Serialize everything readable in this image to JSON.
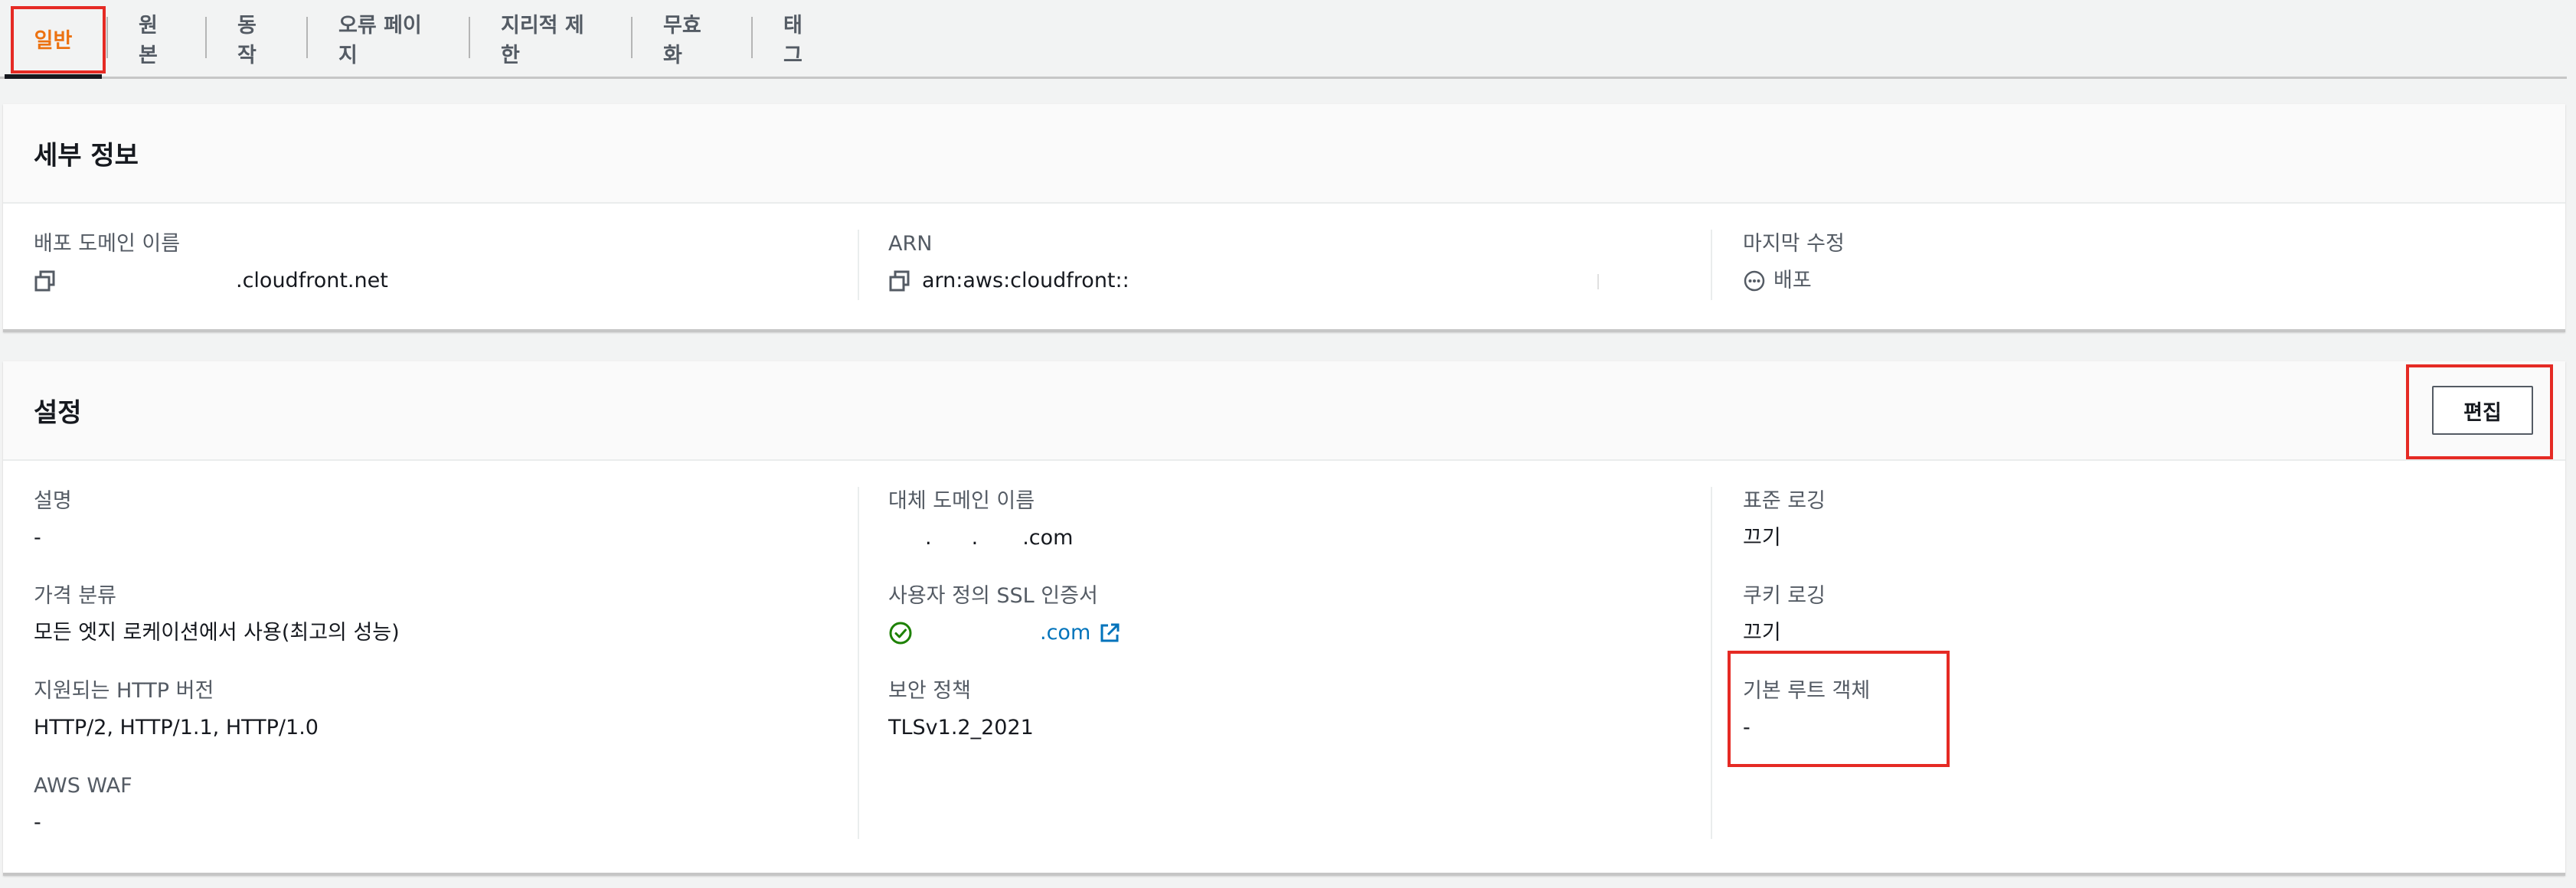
{
  "tabs": [
    {
      "label": "일반",
      "active": true
    },
    {
      "label": "원본",
      "active": false
    },
    {
      "label": "동작",
      "active": false
    },
    {
      "label": "오류 페이지",
      "active": false
    },
    {
      "label": "지리적 제한",
      "active": false
    },
    {
      "label": "무효화",
      "active": false
    },
    {
      "label": "태그",
      "active": false
    }
  ],
  "details": {
    "title": "세부 정보",
    "domain_label": "배포 도메인 이름",
    "domain_value": ".cloudfront.net",
    "arn_label": "ARN",
    "arn_value": "arn:aws:cloudfront::",
    "modified_label": "마지막 수정",
    "modified_value": "배포"
  },
  "settings": {
    "title": "설정",
    "edit_label": "편집",
    "description_label": "설명",
    "description_value": "-",
    "price_label": "가격 분류",
    "price_value": "모든 엣지 로케이션에서 사용(최고의 성능)",
    "http_label": "지원되는 HTTP 버전",
    "http_value": "HTTP/2, HTTP/1.1, HTTP/1.0",
    "waf_label": "AWS WAF",
    "waf_value": "-",
    "alt_domain_label": "대체 도메인 이름",
    "alt_domain_dot1": ".",
    "alt_domain_dot2": ".",
    "alt_domain_suffix": ".com",
    "ssl_label": "사용자 정의 SSL 인증서",
    "ssl_value": ".com",
    "security_label": "보안 정책",
    "security_value": "TLSv1.2_2021",
    "logging_label": "표준 로깅",
    "logging_value": "끄기",
    "cookie_label": "쿠키 로깅",
    "cookie_value": "끄기",
    "root_label": "기본 루트 객체",
    "root_value": "-"
  },
  "colors": {
    "accent": "#ec7211",
    "link": "#0073bb",
    "success": "#1d8102",
    "highlight": "#e52a24"
  }
}
